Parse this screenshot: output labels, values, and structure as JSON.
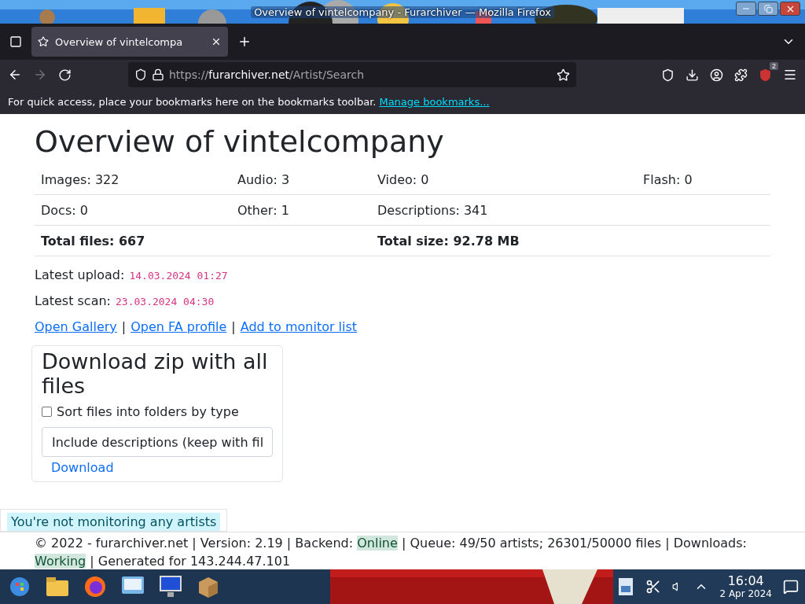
{
  "window": {
    "title": "Overview of vintelcompany - Furarchiver — Mozilla Firefox"
  },
  "tabs": [
    {
      "label": "Overview of vintelcompa",
      "selected": true
    }
  ],
  "address_bar": {
    "scheme": "https://",
    "domain": "furarchiver.net",
    "path": "/Artist/Search"
  },
  "toolbar": {
    "extension_badge": "2"
  },
  "bookmarks_bar": {
    "message": "For quick access, place your bookmarks here on the bookmarks toolbar.",
    "link": "Manage bookmarks..."
  },
  "page": {
    "heading": "Overview of vintelcompany",
    "stats_rows": [
      {
        "bold": false,
        "cells": [
          "Images: 322",
          "Audio: 3",
          "Video: 0",
          "Flash: 0"
        ]
      },
      {
        "bold": false,
        "cells": [
          "Docs: 0",
          "Other: 1",
          "Descriptions: 341"
        ]
      },
      {
        "bold": true,
        "cells": [
          "Total files: 667",
          "Total size: 92.78 MB"
        ]
      }
    ],
    "dates": [
      {
        "label": "Latest upload:",
        "value": "14.03.2024 01:27"
      },
      {
        "label": "Latest scan:",
        "value": "23.03.2024 04:30"
      }
    ],
    "links": [
      {
        "text": "Open Gallery",
        "separator": "|"
      },
      {
        "text": "Open FA profile",
        "separator": "|"
      },
      {
        "text": "Add to monitor list"
      }
    ],
    "download": {
      "title": "Download zip with all files",
      "checkbox": {
        "label": "Sort files into folders by type",
        "checked": false
      },
      "select": {
        "value": "Include descriptions (keep with fil"
      },
      "button": "Download"
    },
    "toast": "You're not monitoring any artists",
    "footer": [
      {
        "text": "© 2022 - furarchiver.net | Version: 2.19 | Backend: ",
        "highlight": false
      },
      {
        "text": "Online",
        "highlight": true
      },
      {
        "text": " | Queue: 49/50 artists; 26301/50000 files | Downloads: ",
        "highlight": false
      },
      {
        "text": "Working",
        "highlight": true
      },
      {
        "text": " | Generated for 143.244.47.101",
        "highlight": false
      }
    ]
  },
  "taskbar": {
    "time": "16:04",
    "date": "2 Apr 2024"
  }
}
